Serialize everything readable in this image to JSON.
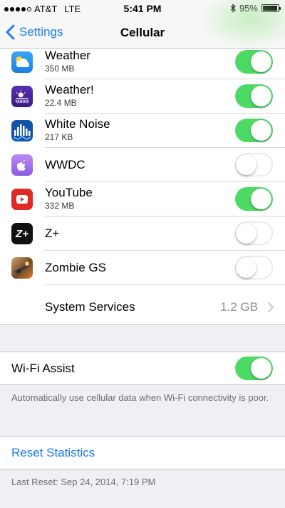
{
  "status_bar": {
    "carrier": "AT&T",
    "network": "LTE",
    "time": "5:41 PM",
    "battery": "95%",
    "battery_level": 0.95,
    "signal_bars_filled": 4,
    "signal_bars_total": 5
  },
  "nav": {
    "back_label": "Settings",
    "title": "Cellular"
  },
  "apps": [
    {
      "name": "Weather",
      "size": "350 MB",
      "enabled": true,
      "icon": "weather-icon"
    },
    {
      "name": "Weather!",
      "size": "22.4 MB",
      "enabled": true,
      "icon": "yahoo-weather-icon",
      "icon_text": "YAHOO!"
    },
    {
      "name": "White Noise",
      "size": "217 KB",
      "enabled": true,
      "icon": "white-noise-icon"
    },
    {
      "name": "WWDC",
      "size": "",
      "enabled": false,
      "icon": "wwdc-icon"
    },
    {
      "name": "YouTube",
      "size": "332 MB",
      "enabled": true,
      "icon": "youtube-icon"
    },
    {
      "name": "Z+",
      "size": "",
      "enabled": false,
      "icon": "z-plus-icon",
      "icon_text": "Z+"
    },
    {
      "name": "Zombie GS",
      "size": "",
      "enabled": false,
      "icon": "zombie-gs-icon"
    }
  ],
  "system_services": {
    "label": "System Services",
    "value": "1.2 GB"
  },
  "wifi_assist": {
    "label": "Wi-Fi Assist",
    "enabled": true,
    "footer": "Automatically use cellular data when Wi-Fi connectivity is poor."
  },
  "reset": {
    "label": "Reset Statistics",
    "last_reset": "Last Reset: Sep 24, 2014, 7:19 PM"
  },
  "colors": {
    "accent": "#1a7cf6",
    "switch_on": "#4cd964"
  }
}
